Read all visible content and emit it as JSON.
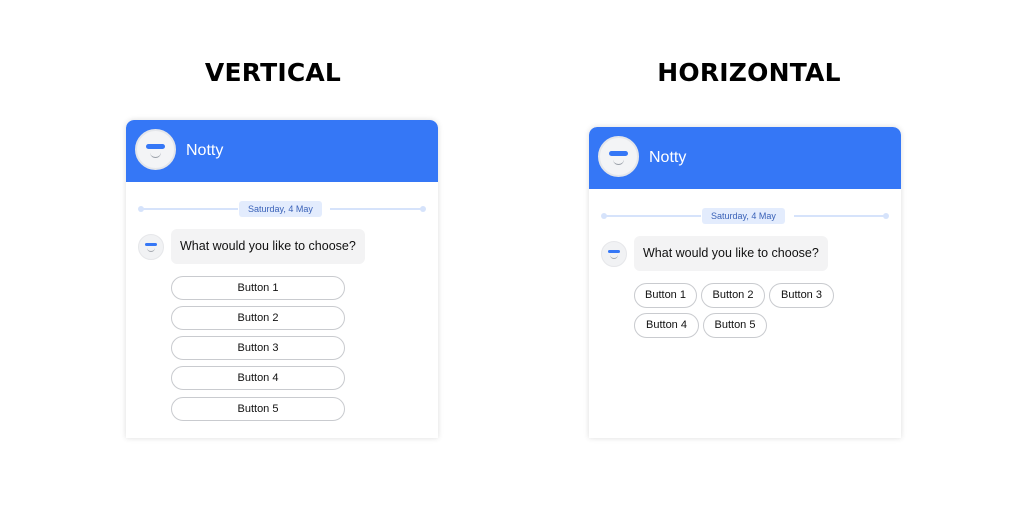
{
  "headings": {
    "vertical": "VERTICAL",
    "horizontal": "HORIZONTAL"
  },
  "chat": {
    "bot_name": "Notty",
    "date_label": "Saturday, 4 May",
    "message": "What would you like to choose?",
    "buttons": [
      "Button 1",
      "Button 2",
      "Button 3",
      "Button 4",
      "Button 5"
    ]
  },
  "colors": {
    "header_bg": "#3577f6",
    "date_chip_bg": "#e3ecfd",
    "bubble_bg": "#f3f3f4",
    "button_border": "#c9cbcf"
  },
  "icons": {
    "avatar": "bot-face-icon"
  }
}
